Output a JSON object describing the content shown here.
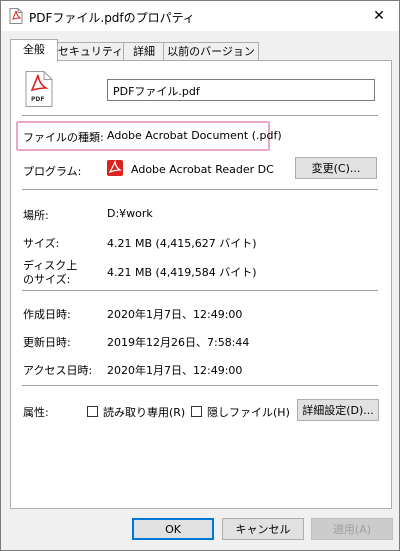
{
  "window": {
    "title": "PDFファイル.pdfのプロパティ",
    "close_glyph": "✕"
  },
  "tabs": [
    {
      "label": "全般",
      "active": true
    },
    {
      "label": "セキュリティ",
      "active": false
    },
    {
      "label": "詳細",
      "active": false
    },
    {
      "label": "以前のバージョン",
      "active": false
    }
  ],
  "general": {
    "file_icon_caption": "PDF",
    "filename": "PDFファイル.pdf",
    "type_label": "ファイルの種類:",
    "type_value": "Adobe Acrobat Document (.pdf)",
    "program_label": "プログラム:",
    "program_value": "Adobe Acrobat Reader DC",
    "change_button": "変更(C)...",
    "location_label": "場所:",
    "location_value": "D:¥work",
    "size_label": "サイズ:",
    "size_value": "4.21 MB (4,415,627 バイト)",
    "size_on_disk_label_1": "ディスク上",
    "size_on_disk_label_2": "のサイズ:",
    "size_on_disk_value": "4.21 MB (4,419,584 バイト)",
    "created_label": "作成日時:",
    "created_value": "2020年1月7日、12:49:00",
    "modified_label": "更新日時:",
    "modified_value": "2019年12月26日、7:58:44",
    "accessed_label": "アクセス日時:",
    "accessed_value": "2020年1月7日、12:49:00",
    "attributes_label": "属性:",
    "readonly_label": "読み取り専用(R)",
    "hidden_label": "隠しファイル(H)",
    "advanced_button": "詳細設定(D)..."
  },
  "footer": {
    "ok": "OK",
    "cancel": "キャンセル",
    "apply": "適用(A)"
  },
  "colors": {
    "highlight": "#e8a9c9",
    "pdf_red": "#d9231f",
    "accent": "#0078d7"
  }
}
